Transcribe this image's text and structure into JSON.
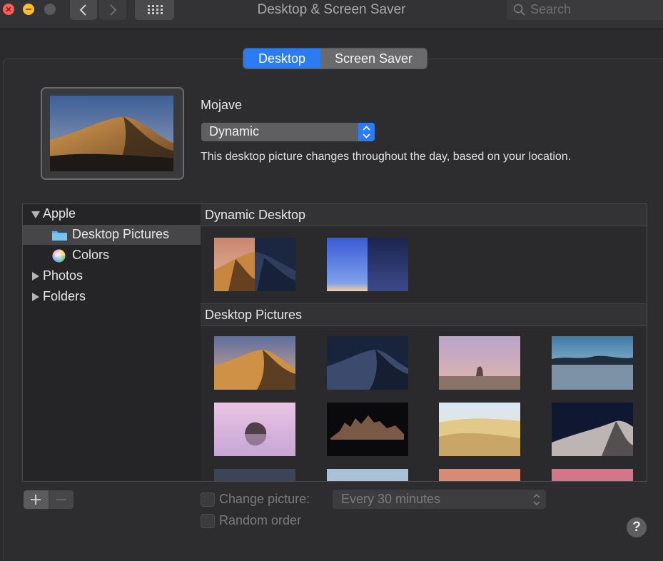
{
  "window": {
    "title": "Desktop & Screen Saver"
  },
  "search": {
    "placeholder": "Search"
  },
  "tabs": {
    "desktop": "Desktop",
    "screen_saver": "Screen Saver"
  },
  "current": {
    "name": "Mojave",
    "mode": "Dynamic",
    "description": "This desktop picture changes throughout the day, based on your location."
  },
  "sidebar": {
    "items": [
      {
        "label": "Apple",
        "icon": "disclosure-open-icon"
      },
      {
        "label": "Desktop Pictures",
        "icon": "folder-icon",
        "selected": true
      },
      {
        "label": "Colors",
        "icon": "color-wheel-icon"
      },
      {
        "label": "Photos",
        "icon": "disclosure-closed-icon"
      },
      {
        "label": "Folders",
        "icon": "disclosure-closed-icon"
      }
    ]
  },
  "gallery": {
    "section1": "Dynamic Desktop",
    "section2": "Desktop Pictures"
  },
  "options": {
    "change_picture": "Change picture:",
    "interval": "Every 30 minutes",
    "random_order": "Random order"
  },
  "buttons": {
    "add": "+",
    "remove": "−",
    "help": "?"
  },
  "colors": {
    "accent": "#2b7cf2",
    "background": "#2b2b2d"
  }
}
